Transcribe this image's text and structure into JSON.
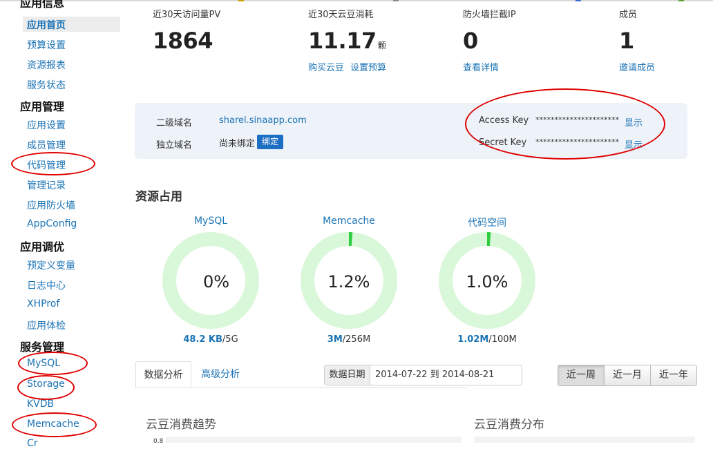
{
  "sidebar": {
    "sections": [
      {
        "title": "应用信息",
        "items": [
          "应用首页",
          "预算设置",
          "资源报表",
          "服务状态"
        ]
      },
      {
        "title": "应用管理",
        "items": [
          "应用设置",
          "成员管理",
          "代码管理",
          "管理记录",
          "应用防火墙",
          "AppConfig"
        ]
      },
      {
        "title": "应用调优",
        "items": [
          "预定义变量",
          "日志中心",
          "XHProf",
          "应用体检"
        ]
      },
      {
        "title": "服务管理",
        "items": [
          "MySQL",
          "Storage",
          "KVDB",
          "Memcache",
          "Cr"
        ]
      }
    ],
    "active": "应用首页"
  },
  "stats": [
    {
      "label": "近30天访问量PV",
      "value": "1864",
      "unit": "",
      "links": []
    },
    {
      "label": "近30天云豆消耗",
      "value": "11.17",
      "unit": "颗",
      "links": [
        "购买云豆",
        "设置预算"
      ]
    },
    {
      "label": "防火墙拦截IP",
      "value": "0",
      "unit": "",
      "links": [
        "查看详情"
      ]
    },
    {
      "label": "成员",
      "value": "1",
      "unit": "",
      "links": [
        "邀请成员"
      ]
    }
  ],
  "domain": {
    "second_level_label": "二级域名",
    "second_level_value": "sharel.sinaapp.com",
    "custom_label": "独立域名",
    "custom_value": "尚未绑定",
    "bind_button": "绑定",
    "access_key_label": "Access Key",
    "access_key_value": "**********************",
    "secret_key_label": "Secret Key",
    "secret_key_value": "**********************",
    "show_label": "显示"
  },
  "resources": {
    "title": "资源占用",
    "items": [
      {
        "name": "MySQL",
        "percent": 0,
        "percent_text": "0%",
        "used": "48.2 KB",
        "total": "/5G"
      },
      {
        "name": "Memcache",
        "percent": 1.2,
        "percent_text": "1.2%",
        "used": "3M",
        "total": "/256M"
      },
      {
        "name": "代码空间",
        "percent": 1.0,
        "percent_text": "1.0%",
        "used": "1.02M",
        "total": "/100M"
      }
    ],
    "colors": {
      "ring": "#d9f7d9",
      "fill": "#2ecc40"
    }
  },
  "analysis": {
    "tabs": [
      "数据分析",
      "高级分析"
    ],
    "date_label": "数据日期",
    "date_value": "2014-07-22 到 2014-08-21",
    "ranges": [
      "近一周",
      "近一月",
      "近一年"
    ],
    "active_range": "近一周",
    "chart_titles": [
      "云豆消费趋势",
      "云豆消费分布"
    ],
    "axis_tick": "0.8"
  }
}
